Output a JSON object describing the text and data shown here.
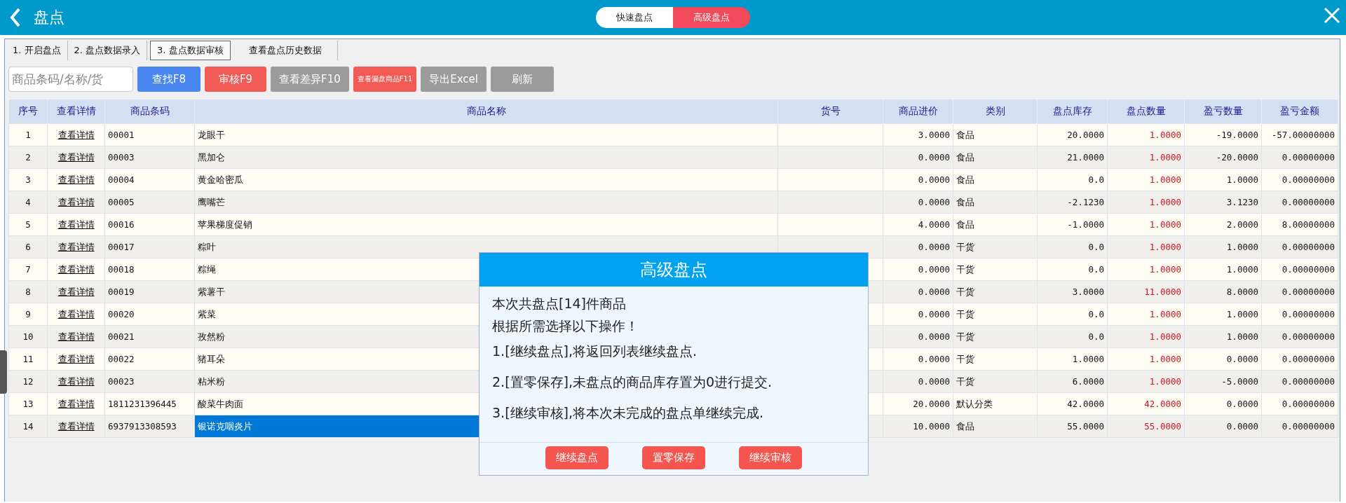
{
  "header": {
    "title": "盘点",
    "modes": [
      {
        "label": "快速盘点",
        "selected": false
      },
      {
        "label": "高级盘点",
        "selected": true
      }
    ]
  },
  "tabs": [
    {
      "label": "1. 开启盘点",
      "selected": false
    },
    {
      "label": "2. 盘点数据录入",
      "selected": false
    },
    {
      "label": "3. 盘点数据审核",
      "selected": true
    },
    {
      "label": "查看盘点历史数据",
      "selected": false
    }
  ],
  "search": {
    "placeholder": "商品条码/名称/货"
  },
  "toolbar": [
    {
      "label": "查找F8",
      "kind": "blue"
    },
    {
      "label": "审核F9",
      "kind": "red"
    },
    {
      "label": "查看差异F10",
      "kind": "gray"
    },
    {
      "label": "查看漏盘商品F11",
      "kind": "red-compact"
    },
    {
      "label": "导出Excel",
      "kind": "gray"
    },
    {
      "label": "刷新",
      "kind": "gray-wide"
    }
  ],
  "table": {
    "columns": [
      "序号",
      "查看详情",
      "商品条码",
      "商品名称",
      "货号",
      "商品进价",
      "类别",
      "盘点库存",
      "盘点数量",
      "盈亏数量",
      "盈亏金额"
    ],
    "rows": [
      {
        "index": "1",
        "detail": "查看详情",
        "barcode": "00001",
        "name": "龙眼干",
        "price": "3.0000",
        "category": "食品",
        "stock": "20.0000",
        "count": "1.0000",
        "diff_qty": "-19.0000",
        "diff_amount": "-57.00000000",
        "selected": false
      },
      {
        "index": "2",
        "detail": "查看详情",
        "barcode": "00003",
        "name": "黑加仑",
        "price": "0.0000",
        "category": "食品",
        "stock": "21.0000",
        "count": "1.0000",
        "diff_qty": "-20.0000",
        "diff_amount": "0.00000000",
        "selected": false
      },
      {
        "index": "3",
        "detail": "查看详情",
        "barcode": "00004",
        "name": "黄金哈密瓜",
        "price": "0.0000",
        "category": "食品",
        "stock": "0.0",
        "count": "1.0000",
        "diff_qty": "1.0000",
        "diff_amount": "0.00000000",
        "selected": false
      },
      {
        "index": "4",
        "detail": "查看详情",
        "barcode": "00005",
        "name": "鹰嘴芒",
        "price": "0.0000",
        "category": "食品",
        "stock": "-2.1230",
        "count": "1.0000",
        "diff_qty": "3.1230",
        "diff_amount": "0.00000000",
        "selected": false
      },
      {
        "index": "5",
        "detail": "查看详情",
        "barcode": "00016",
        "name": "苹果梯度促销",
        "price": "4.0000",
        "category": "食品",
        "stock": "-1.0000",
        "count": "1.0000",
        "diff_qty": "2.0000",
        "diff_amount": "8.00000000",
        "selected": false
      },
      {
        "index": "6",
        "detail": "查看详情",
        "barcode": "00017",
        "name": "粽叶",
        "price": "0.0000",
        "category": "干货",
        "stock": "0.0",
        "count": "1.0000",
        "diff_qty": "1.0000",
        "diff_amount": "0.00000000",
        "selected": false
      },
      {
        "index": "7",
        "detail": "查看详情",
        "barcode": "00018",
        "name": "粽绳",
        "price": "0.0000",
        "category": "干货",
        "stock": "0.0",
        "count": "1.0000",
        "diff_qty": "1.0000",
        "diff_amount": "0.00000000",
        "selected": false
      },
      {
        "index": "8",
        "detail": "查看详情",
        "barcode": "00019",
        "name": "紫薯干",
        "price": "0.0000",
        "category": "干货",
        "stock": "3.0000",
        "count": "11.0000",
        "diff_qty": "8.0000",
        "diff_amount": "0.00000000",
        "selected": false
      },
      {
        "index": "9",
        "detail": "查看详情",
        "barcode": "00020",
        "name": "紫菜",
        "price": "0.0000",
        "category": "干货",
        "stock": "0.0",
        "count": "1.0000",
        "diff_qty": "1.0000",
        "diff_amount": "0.00000000",
        "selected": false
      },
      {
        "index": "10",
        "detail": "查看详情",
        "barcode": "00021",
        "name": "孜然粉",
        "price": "0.0000",
        "category": "干货",
        "stock": "0.0",
        "count": "1.0000",
        "diff_qty": "1.0000",
        "diff_amount": "0.00000000",
        "selected": false
      },
      {
        "index": "11",
        "detail": "查看详情",
        "barcode": "00022",
        "name": "猪耳朵",
        "price": "0.0000",
        "category": "干货",
        "stock": "1.0000",
        "count": "1.0000",
        "diff_qty": "0.0000",
        "diff_amount": "0.00000000",
        "selected": false
      },
      {
        "index": "12",
        "detail": "查看详情",
        "barcode": "00023",
        "name": "粘米粉",
        "price": "0.0000",
        "category": "干货",
        "stock": "6.0000",
        "count": "1.0000",
        "diff_qty": "-5.0000",
        "diff_amount": "0.00000000",
        "selected": false
      },
      {
        "index": "13",
        "detail": "查看详情",
        "barcode": "1811231396445",
        "name": "酸菜牛肉面",
        "price": "20.0000",
        "category": "默认分类",
        "stock": "42.0000",
        "count": "42.0000",
        "diff_qty": "0.0000",
        "diff_amount": "0.00000000",
        "selected": false
      },
      {
        "index": "14",
        "detail": "查看详情",
        "barcode": "6937913308593",
        "name": "银诺克咽炎片",
        "price": "10.0000",
        "category": "食品",
        "stock": "55.0000",
        "count": "55.0000",
        "diff_qty": "0.0000",
        "diff_amount": "0.00000000",
        "selected": true
      }
    ]
  },
  "dialog": {
    "title": "高级盘点",
    "lines": [
      {
        "text": "本次共盘点[14]件商品",
        "kind": "intro"
      },
      {
        "text": "根据所需选择以下操作！",
        "kind": "intro"
      },
      {
        "text": "1.[继续盘点],将返回列表继续盘点.",
        "kind": "option"
      },
      {
        "text": "2.[置零保存],未盘点的商品库存置为0进行提交.",
        "kind": "option"
      },
      {
        "text": "3.[继续审核],将本次未完成的盘点单继续完成.",
        "kind": "option"
      }
    ],
    "buttons": [
      "继续盘点",
      "置零保存",
      "继续审核"
    ]
  }
}
